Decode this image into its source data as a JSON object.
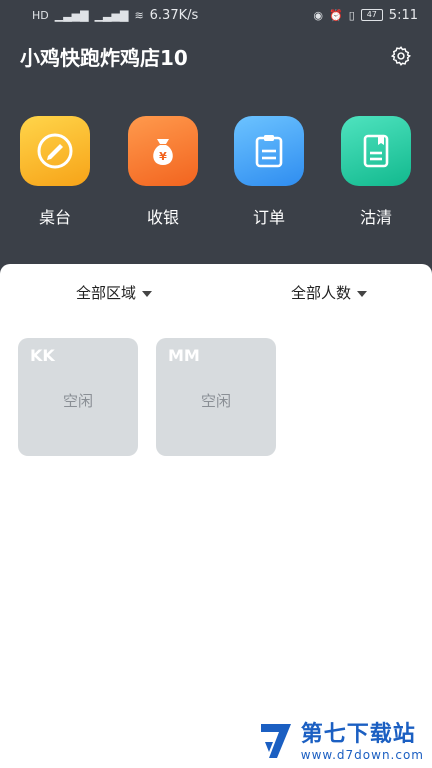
{
  "status_bar": {
    "network_speed": "6.37K/s",
    "battery": "47",
    "time": "5:11"
  },
  "header": {
    "store_name": "小鸡快跑炸鸡店10",
    "settings_icon": "gear-icon"
  },
  "actions": [
    {
      "label": "桌台",
      "icon": "pencil-circle-icon",
      "color": "#f9b625"
    },
    {
      "label": "收银",
      "icon": "money-bag-icon",
      "color": "#f27a33"
    },
    {
      "label": "订单",
      "icon": "clipboard-icon",
      "color": "#3b9cf2"
    },
    {
      "label": "沽清",
      "icon": "notebook-icon",
      "color": "#1fc79d"
    }
  ],
  "filters": {
    "area": "全部区域",
    "people": "全部人数"
  },
  "tables": [
    {
      "code": "KK",
      "status": "空闲"
    },
    {
      "code": "MM",
      "status": "空闲"
    }
  ],
  "watermark": {
    "name": "第七下载站",
    "url": "www.d7down.com"
  },
  "colors": {
    "header_bg": "#3b4048",
    "card_bg": "#d7dbde",
    "watermark": "#1b5fc2"
  }
}
